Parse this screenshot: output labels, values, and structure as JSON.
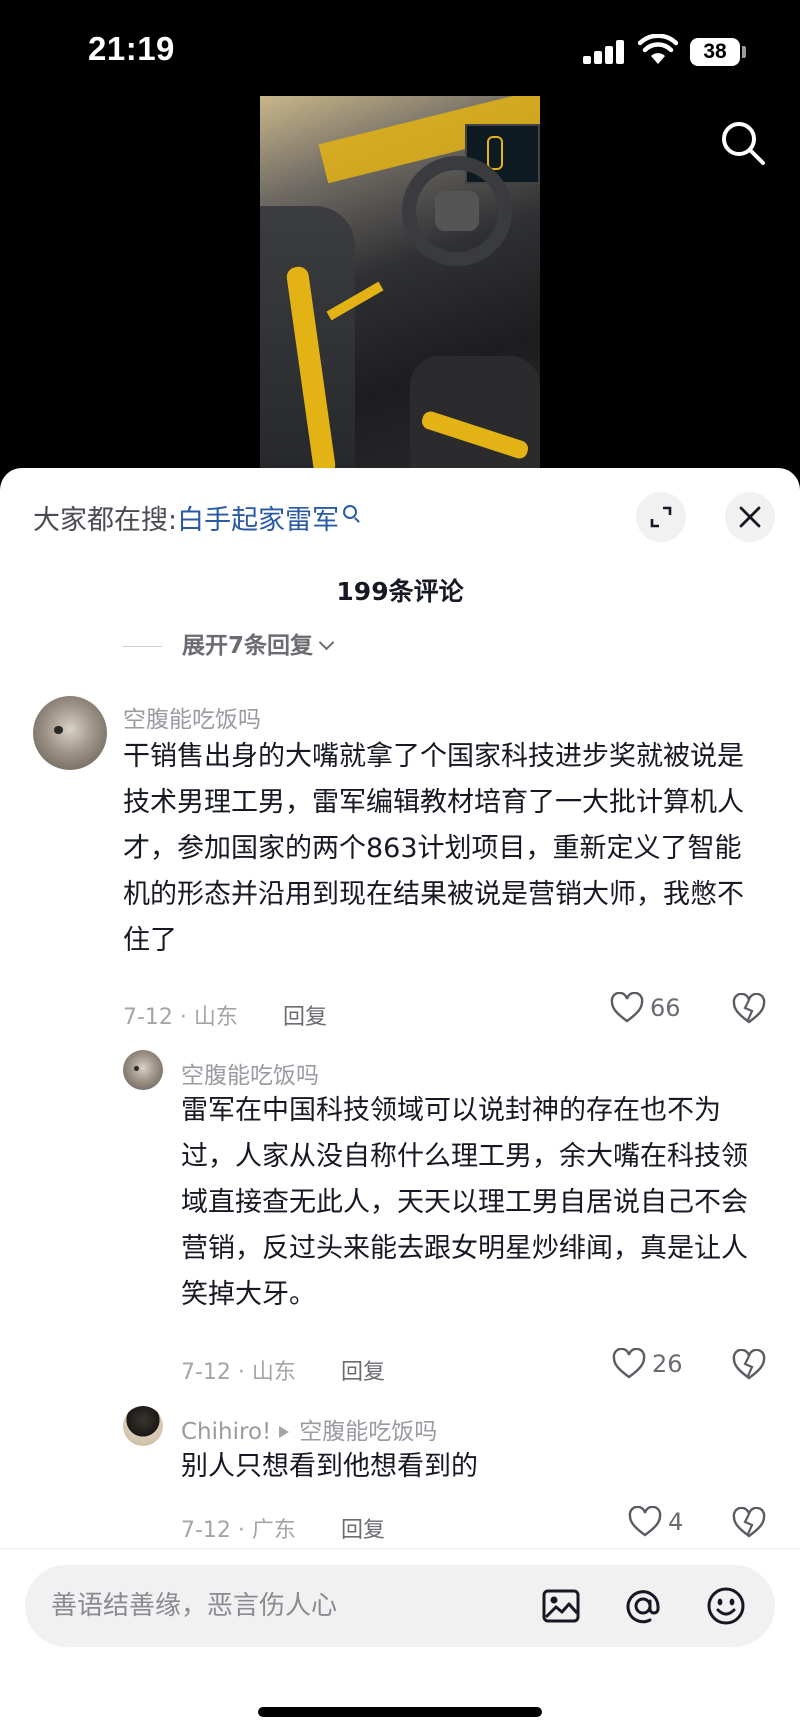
{
  "status_bar": {
    "time": "21:19",
    "battery": "38"
  },
  "search_bar": {
    "label": "大家都在搜:",
    "keyword": "白手起家雷军"
  },
  "comments_header": {
    "count_text": "199条评论",
    "expand_text": "展开7条回复"
  },
  "comments": [
    {
      "username": "空腹能吃饭吗",
      "text": "干销售出身的大嘴就拿了个国家科技进步奖就被说是技术男理工男，雷军编辑教材培育了一大批计算机人才，参加国家的两个863计划项目，重新定义了智能机的形态并沿用到现在结果被说是营销大师，我憋不住了",
      "date_location": "7-12 · 山东",
      "reply_label": "回复",
      "likes": "66"
    },
    {
      "username": "空腹能吃饭吗",
      "text": "雷军在中国科技领域可以说封神的存在也不为过，人家从没自称什么理工男，余大嘴在科技领域直接查无此人，天天以理工男自居说自己不会营销，反过头来能去跟女明星炒绯闻，真是让人笑掉大牙。",
      "date_location": "7-12 · 山东",
      "reply_label": "回复",
      "likes": "26"
    },
    {
      "username": "Chihiro!",
      "reply_to": "空腹能吃饭吗",
      "text": "别人只想看到他想看到的",
      "date_location": "7-12 · 广东",
      "reply_label": "回复",
      "likes": "4"
    }
  ],
  "input": {
    "placeholder": "善语结善缘，恶言伤人心"
  },
  "icons": {
    "search": "search-icon",
    "expand": "expand-icon",
    "close": "close-icon",
    "like": "heart-icon",
    "dislike": "broken-heart-icon",
    "image": "image-icon",
    "mention": "at-icon",
    "emoji": "emoji-icon"
  }
}
